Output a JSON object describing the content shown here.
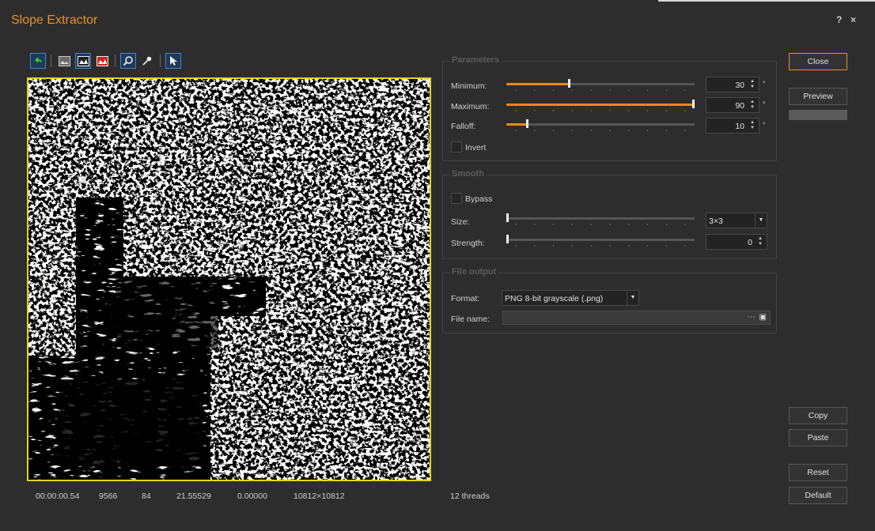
{
  "window": {
    "title": "Slope Extractor",
    "help_label": "?",
    "close_label": "×"
  },
  "toolbar": {
    "icons": [
      "undo-icon",
      "image-icon",
      "image-pick-icon",
      "image-red-icon",
      "zoom-icon",
      "eyedropper-icon",
      "pointer-icon"
    ]
  },
  "status": {
    "time": "00:00:00.54",
    "v1": "9566",
    "v2": "84",
    "v3": "21.55529",
    "v4": "0.00000",
    "size": "10812×10812",
    "threads": "12 threads"
  },
  "parameters": {
    "title": "Parameters",
    "minimum": {
      "label": "Minimum:",
      "value": "30",
      "unit": "°",
      "fraction": 0.333
    },
    "maximum": {
      "label": "Maximum:",
      "value": "90",
      "unit": "°",
      "fraction": 1.0
    },
    "falloff": {
      "label": "Falloff:",
      "value": "10",
      "unit": "°",
      "fraction": 0.111
    },
    "invert_label": "Invert",
    "invert_checked": false
  },
  "smooth": {
    "title": "Smooth",
    "bypass_label": "Bypass",
    "bypass_checked": false,
    "size": {
      "label": "Size:",
      "value": "3×3",
      "fraction": 0
    },
    "strength": {
      "label": "Strength:",
      "value": "0",
      "fraction": 0
    }
  },
  "file_output": {
    "title": "File output",
    "format_label": "Format:",
    "format_value": "PNG 8-bit grayscale (.png)",
    "filename_label": "File name:",
    "filename_value": ""
  },
  "buttons": {
    "close": "Close",
    "preview": "Preview",
    "copy": "Copy",
    "paste": "Paste",
    "reset": "Reset",
    "default": "Default"
  },
  "colors": {
    "accent": "#e8902a",
    "preview_border": "#e3d51f",
    "slider_fill": "#e88a1a"
  }
}
